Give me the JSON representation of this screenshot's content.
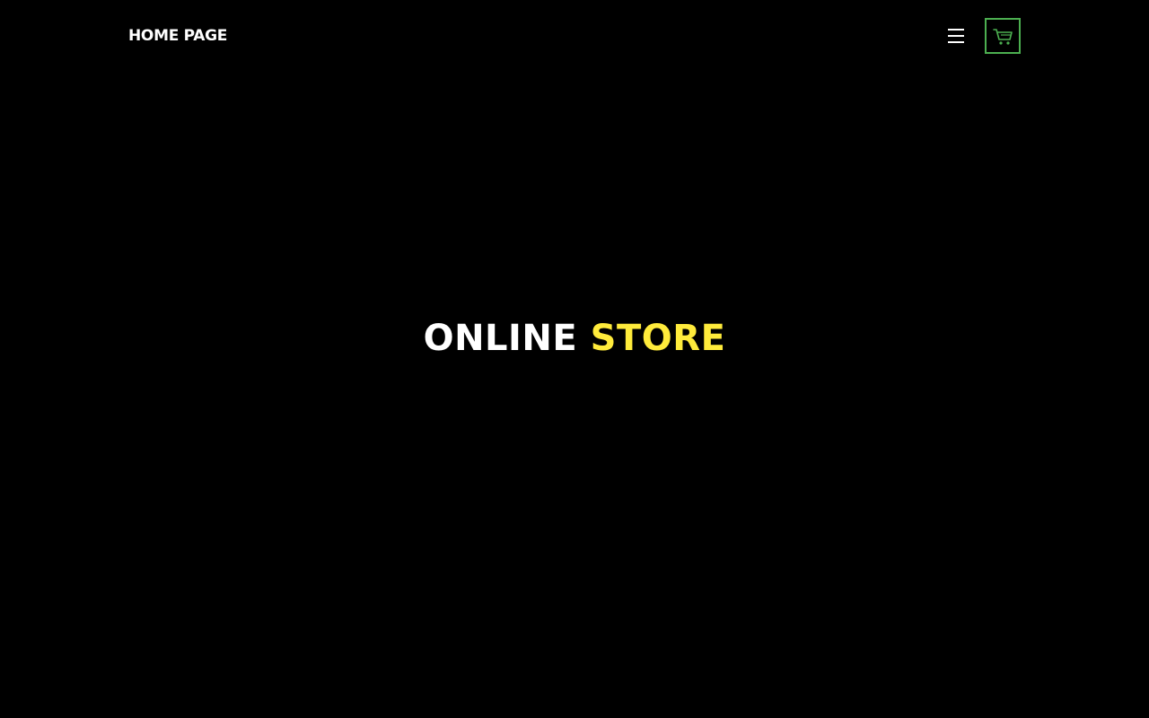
{
  "header": {
    "home_label": "HOME PAGE",
    "menu_icon": "hamburger-menu-icon",
    "cart_icon": "shopping-cart-icon"
  },
  "hero": {
    "title_part1": "ONLINE",
    "title_part2": "STORE"
  },
  "colors": {
    "background": "#000000",
    "text": "#ffffff",
    "accent_yellow": "#ffeb3b",
    "cart_border_green": "#4caf50"
  }
}
